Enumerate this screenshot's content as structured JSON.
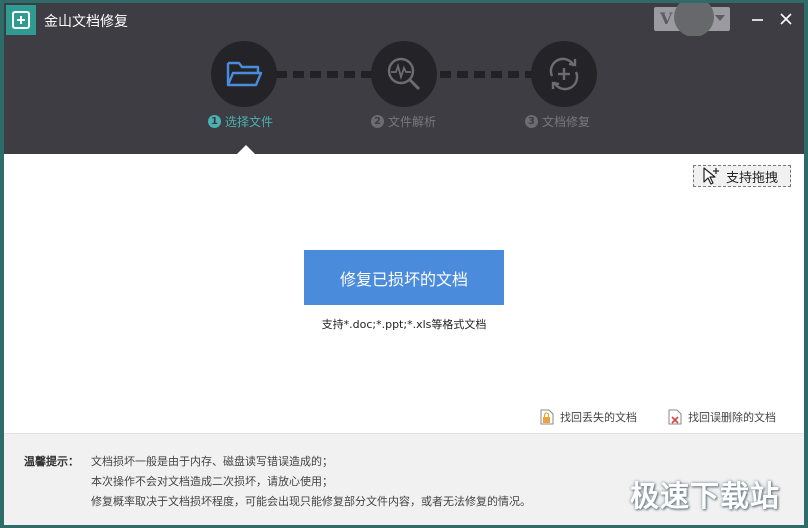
{
  "titlebar": {
    "title": "金山文档修复",
    "vip_letter": "V"
  },
  "steps": [
    {
      "number": "1",
      "label": "选择文件",
      "icon": "folder-icon",
      "active": true
    },
    {
      "number": "2",
      "label": "文件解析",
      "icon": "analyze-icon",
      "active": false
    },
    {
      "number": "3",
      "label": "文档修复",
      "icon": "repair-icon",
      "active": false
    }
  ],
  "drag_hint": {
    "label": "支持拖拽"
  },
  "main": {
    "repair_button": "修复已损坏的文档",
    "formats_text": "支持*.doc;*.ppt;*.xls等格式文档"
  },
  "links": {
    "recover_lost": "找回丢失的文档",
    "recover_deleted": "找回误删除的文档"
  },
  "tips": {
    "label": "温馨提示：",
    "lines": [
      "文档损坏一般是由于内存、磁盘读写错误造成的；",
      "本次操作不会对文档造成二次损坏，请放心使用；",
      "修复概率取决于文档损坏程度，可能会出现只能修复部分文件内容，或者无法修复的情况。"
    ]
  },
  "watermark": "极速下载站",
  "colors": {
    "header_bg": "#3e3d43",
    "accent": "#4ab0b1",
    "button_blue": "#4a8bdb"
  }
}
